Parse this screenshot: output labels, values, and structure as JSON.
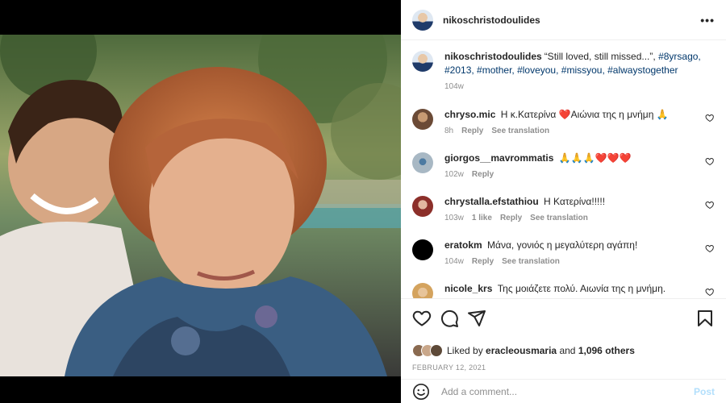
{
  "post": {
    "owner_username": "nikoschristodoulides",
    "caption": {
      "username": "nikoschristodoulides",
      "text": "“Still loved, still missed...”, ",
      "hashtags_line1": "#8yrsago, #2013,",
      "hashtags_line2": "#mother, #loveyou, #missyou, #alwaystogether",
      "time": "104w"
    },
    "more_icon": "more-horizontal-icon"
  },
  "comments": [
    {
      "username": "chryso.mic",
      "text_a": "Η κ.Κατερίνα",
      "text_b": "Αιώνια της η μνήμη",
      "emoji_a": "❤️",
      "emoji_b": "🙏",
      "time": "8h",
      "likes": "",
      "reply": "Reply",
      "translate": "See translation"
    },
    {
      "username": "giorgos__mavrommatis",
      "text": "🙏🙏🙏❤️❤️❤️",
      "time": "102w",
      "reply": "Reply"
    },
    {
      "username": "chrystalla.efstathiou",
      "text": "Η Κατερίνα!!!!!",
      "time": "103w",
      "likes": "1 like",
      "reply": "Reply",
      "translate": "See translation"
    },
    {
      "username": "eratokm",
      "text": "Μάνα, γονιός η μεγαλύτερη αγάπη!",
      "time": "104w",
      "reply": "Reply",
      "translate": "See translation"
    },
    {
      "username": "nicole_krs",
      "text": "Της μοιάζετε πολύ. Αιωνία της η μνήμη."
    }
  ],
  "actions": {
    "icons": [
      "heart-icon",
      "comment-icon",
      "share-icon",
      "bookmark-icon"
    ]
  },
  "likes": {
    "liked_by": "Liked by",
    "user": "eracleousmaria",
    "and": "and",
    "others": "1,096 others"
  },
  "date": "FEBRUARY 12, 2021",
  "add_comment": {
    "placeholder": "Add a comment...",
    "post_label": "Post",
    "emoji_icon": "smiley-icon"
  },
  "colors": {
    "link": "#00376b",
    "muted": "#8e8e8e",
    "post_button": "#b2dffc",
    "heart_red": "#ed4956"
  }
}
